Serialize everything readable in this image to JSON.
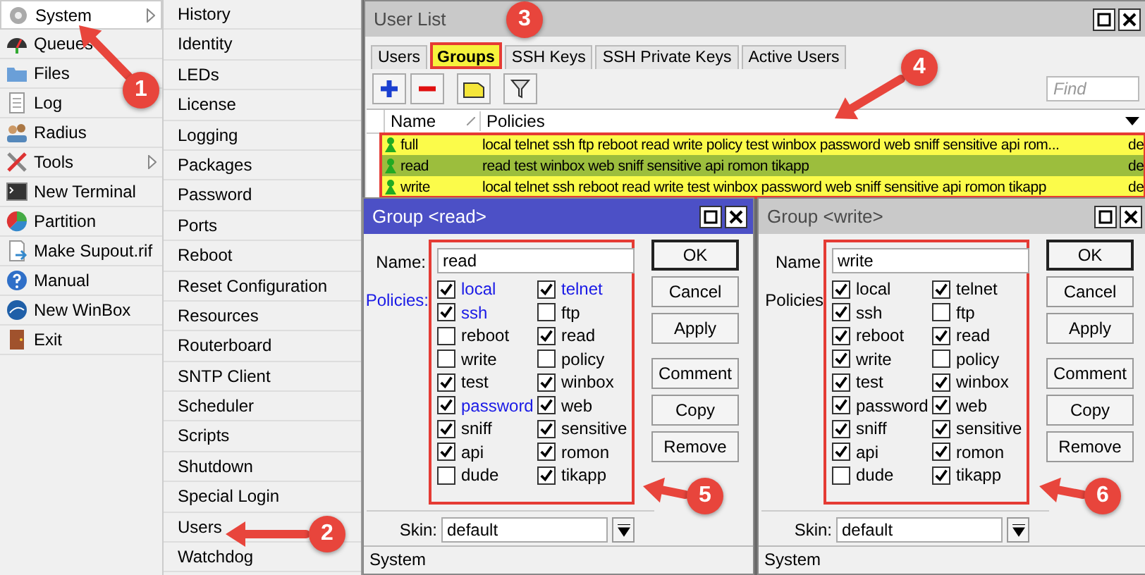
{
  "main_menu": [
    {
      "label": "System",
      "selected": true,
      "has_submenu": true
    },
    {
      "label": "Queues",
      "selected": false,
      "has_submenu": false
    },
    {
      "label": "Files",
      "selected": false,
      "has_submenu": false
    },
    {
      "label": "Log",
      "selected": false,
      "has_submenu": false
    },
    {
      "label": "Radius",
      "selected": false,
      "has_submenu": false
    },
    {
      "label": "Tools",
      "selected": false,
      "has_submenu": true
    },
    {
      "label": "New Terminal",
      "selected": false,
      "has_submenu": false
    },
    {
      "label": "Partition",
      "selected": false,
      "has_submenu": false
    },
    {
      "label": "Make Supout.rif",
      "selected": false,
      "has_submenu": false
    },
    {
      "label": "Manual",
      "selected": false,
      "has_submenu": false
    },
    {
      "label": "New WinBox",
      "selected": false,
      "has_submenu": false
    },
    {
      "label": "Exit",
      "selected": false,
      "has_submenu": false
    }
  ],
  "submenu": [
    "History",
    "Identity",
    "LEDs",
    "License",
    "Logging",
    "Packages",
    "Password",
    "Ports",
    "Reboot",
    "Reset Configuration",
    "Resources",
    "Routerboard",
    "SNTP Client",
    "Scheduler",
    "Scripts",
    "Shutdown",
    "Special Login",
    "Users",
    "Watchdog"
  ],
  "user_list": {
    "title": "User List",
    "tabs": [
      {
        "label": "Users",
        "selected": false,
        "highlighted": false
      },
      {
        "label": "Groups",
        "selected": true,
        "highlighted": true
      },
      {
        "label": "SSH Keys",
        "selected": false,
        "highlighted": false
      },
      {
        "label": "SSH Private Keys",
        "selected": false,
        "highlighted": false
      },
      {
        "label": "Active Users",
        "selected": false,
        "highlighted": false
      }
    ],
    "find": {
      "placeholder": "Find"
    },
    "columns": [
      "Name",
      "Policies"
    ],
    "rows": [
      {
        "name": "full",
        "policies": "local telnet ssh ftp reboot read write policy test winbox password web sniff sensitive api rom...",
        "column_3": "de",
        "selected": false,
        "highlighted": true
      },
      {
        "name": "read",
        "policies": "read test winbox web sniff sensitive api romon tikapp",
        "column_3": "de",
        "selected": true,
        "highlighted": true
      },
      {
        "name": "write",
        "policies": "local telnet ssh reboot read write test winbox password web sniff sensitive api romon tikapp",
        "column_3": "de",
        "selected": false,
        "highlighted": true
      }
    ]
  },
  "dialogs": [
    {
      "title": "Group <read>",
      "active": true,
      "highlighted": true,
      "name_label": "Name:",
      "name": "read",
      "policies_label": "Policies:",
      "policies_label_modified": true,
      "policies": [
        {
          "label": "local",
          "checked": true,
          "modified": true
        },
        {
          "label": "telnet",
          "checked": true,
          "modified": true
        },
        {
          "label": "ssh",
          "checked": true,
          "modified": true
        },
        {
          "label": "ftp",
          "checked": false,
          "modified": false
        },
        {
          "label": "reboot",
          "checked": false,
          "modified": false
        },
        {
          "label": "read",
          "checked": true,
          "modified": false
        },
        {
          "label": "write",
          "checked": false,
          "modified": false
        },
        {
          "label": "policy",
          "checked": false,
          "modified": false
        },
        {
          "label": "test",
          "checked": true,
          "modified": false
        },
        {
          "label": "winbox",
          "checked": true,
          "modified": false
        },
        {
          "label": "password",
          "checked": true,
          "modified": true
        },
        {
          "label": "web",
          "checked": true,
          "modified": false
        },
        {
          "label": "sniff",
          "checked": true,
          "modified": false
        },
        {
          "label": "sensitive",
          "checked": true,
          "modified": false
        },
        {
          "label": "api",
          "checked": true,
          "modified": false
        },
        {
          "label": "romon",
          "checked": true,
          "modified": false
        },
        {
          "label": "dude",
          "checked": false,
          "modified": false
        },
        {
          "label": "tikapp",
          "checked": true,
          "modified": false
        }
      ],
      "buttons": [
        "OK",
        "Cancel",
        "Apply",
        "Comment",
        "Copy",
        "Remove"
      ],
      "skin_label": "Skin:",
      "skin": "default",
      "status": "System"
    },
    {
      "title": "Group <write>",
      "active": false,
      "highlighted": true,
      "name_label": "Name",
      "name": "write",
      "policies_label": "Policies",
      "policies_label_modified": false,
      "policies": [
        {
          "label": "local",
          "checked": true,
          "modified": false
        },
        {
          "label": "telnet",
          "checked": true,
          "modified": false
        },
        {
          "label": "ssh",
          "checked": true,
          "modified": false
        },
        {
          "label": "ftp",
          "checked": false,
          "modified": false
        },
        {
          "label": "reboot",
          "checked": true,
          "modified": false
        },
        {
          "label": "read",
          "checked": true,
          "modified": false
        },
        {
          "label": "write",
          "checked": true,
          "modified": false
        },
        {
          "label": "policy",
          "checked": false,
          "modified": false
        },
        {
          "label": "test",
          "checked": true,
          "modified": false
        },
        {
          "label": "winbox",
          "checked": true,
          "modified": false
        },
        {
          "label": "password",
          "checked": true,
          "modified": false
        },
        {
          "label": "web",
          "checked": true,
          "modified": false
        },
        {
          "label": "sniff",
          "checked": true,
          "modified": false
        },
        {
          "label": "sensitive",
          "checked": true,
          "modified": false
        },
        {
          "label": "api",
          "checked": true,
          "modified": false
        },
        {
          "label": "romon",
          "checked": true,
          "modified": false
        },
        {
          "label": "dude",
          "checked": false,
          "modified": false
        },
        {
          "label": "tikapp",
          "checked": true,
          "modified": false
        }
      ],
      "buttons": [
        "OK",
        "Cancel",
        "Apply",
        "Comment",
        "Copy",
        "Remove"
      ],
      "skin_label": "Skin:",
      "skin": "default",
      "status": "System"
    }
  ],
  "annotations": [
    {
      "kind": "arrow",
      "label": "1"
    },
    {
      "kind": "arrow",
      "label": "2"
    },
    {
      "kind": "badge",
      "label": "3"
    },
    {
      "kind": "arrow",
      "label": "4"
    },
    {
      "kind": "arrow",
      "label": "5"
    },
    {
      "kind": "arrow",
      "label": "6"
    }
  ]
}
